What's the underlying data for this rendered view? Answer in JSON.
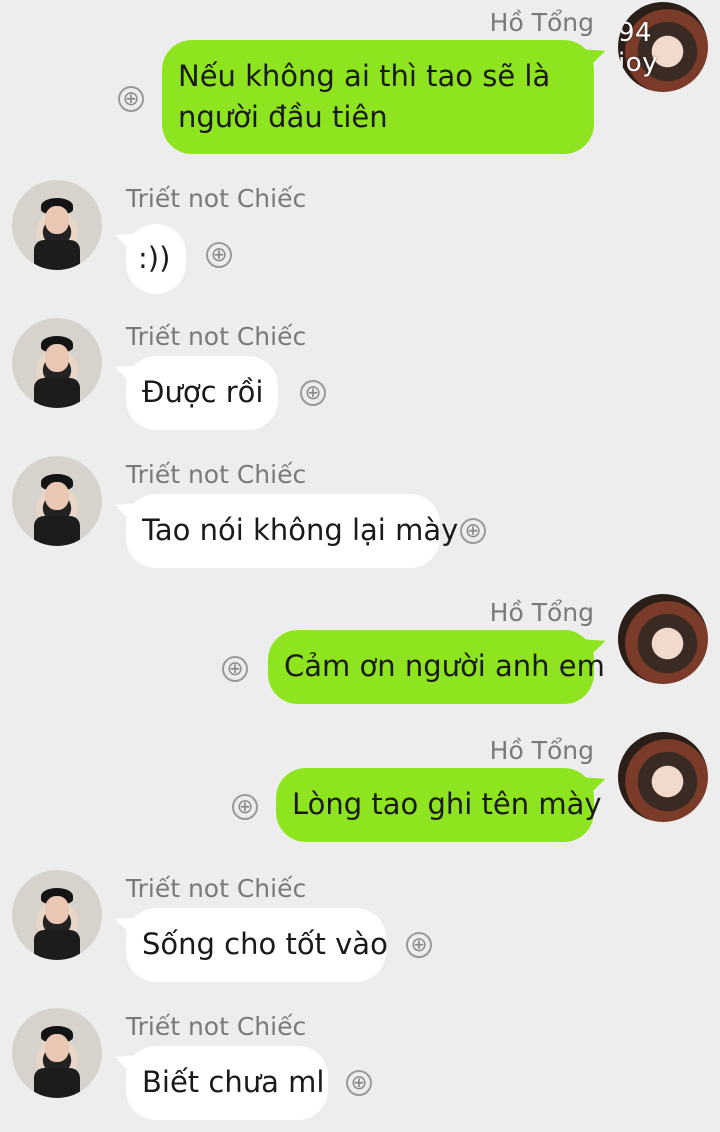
{
  "chat": {
    "messages": [
      {
        "sender": "Hồ Tổng",
        "text_line1": "Nếu không ai thì tao sẽ là",
        "text_line2": "người đầu tiên",
        "avatar_caption": "94 joy"
      },
      {
        "sender": "Triết not Chiếc",
        "text": ":))"
      },
      {
        "sender": "Triết not Chiếc",
        "text": "Được rồi"
      },
      {
        "sender": "Triết not Chiếc",
        "text": "Tao nói không lại mày"
      },
      {
        "sender": "Hồ Tổng",
        "text": "Cảm ơn người anh em"
      },
      {
        "sender": "Hồ Tổng",
        "text": "Lòng tao ghi tên mày"
      },
      {
        "sender": "Triết not Chiếc",
        "text": "Sống cho tốt vào"
      },
      {
        "sender": "Triết not Chiếc",
        "text": "Biết chưa ml"
      }
    ],
    "plus_icon": "⊕"
  }
}
